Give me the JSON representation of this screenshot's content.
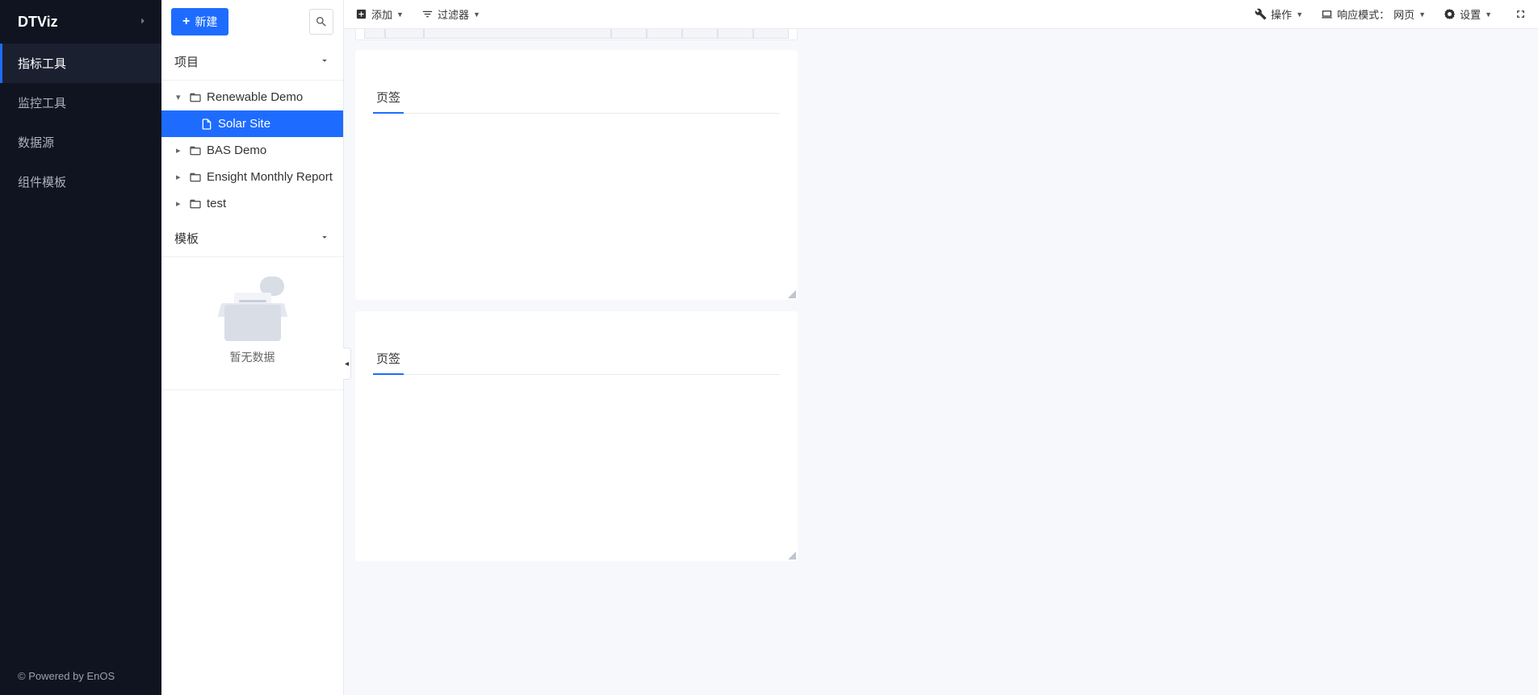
{
  "brand": "DTViz",
  "nav": [
    {
      "label": "指标工具",
      "active": true
    },
    {
      "label": "监控工具",
      "active": false
    },
    {
      "label": "数据源",
      "active": false
    },
    {
      "label": "组件模板",
      "active": false
    }
  ],
  "footer": "© Powered by EnOS",
  "panel": {
    "new_btn": "新建",
    "section_project": "项目",
    "section_template": "模板",
    "tree": [
      {
        "label": "Renewable Demo",
        "type": "folder",
        "expanded": true,
        "children": [
          {
            "label": "Solar Site",
            "type": "file",
            "selected": true
          }
        ]
      },
      {
        "label": "BAS Demo",
        "type": "folder",
        "expanded": false
      },
      {
        "label": "Ensight Monthly Report",
        "type": "folder",
        "expanded": false
      },
      {
        "label": "test",
        "type": "folder",
        "expanded": false
      }
    ],
    "empty_text": "暂无数据"
  },
  "toolbar": {
    "add": "添加",
    "filter": "过滤器",
    "operate": "操作",
    "responsive_label": "响应模式：",
    "responsive_value": "网页",
    "settings": "设置"
  },
  "cards": {
    "stub_text": "",
    "tab_label": "页签"
  }
}
